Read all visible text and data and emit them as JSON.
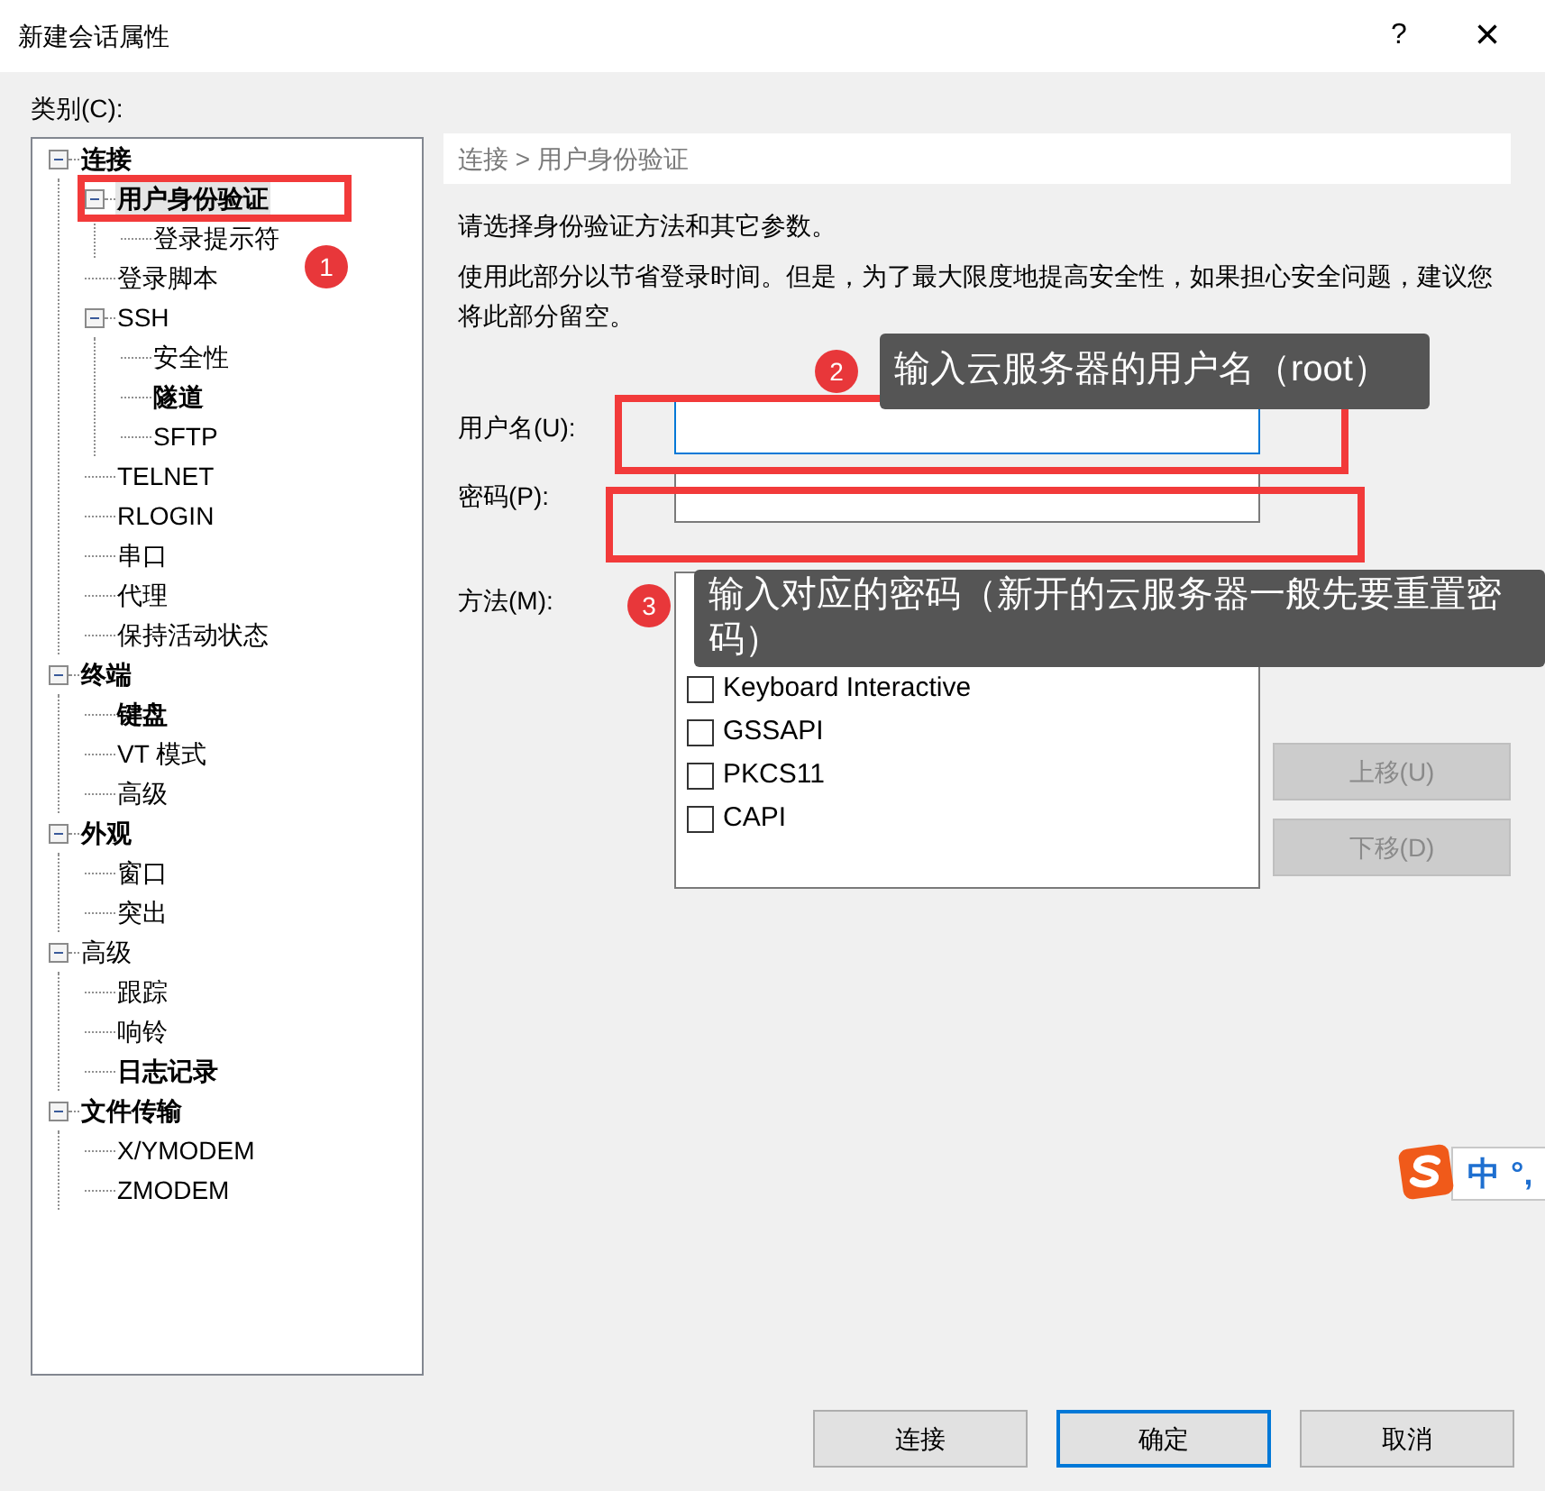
{
  "window": {
    "title": "新建会话属性",
    "help": "?",
    "close": "×"
  },
  "category_label": "类别(C):",
  "tree": [
    {
      "label": "连接",
      "modified": true,
      "selected": false,
      "expanded": true,
      "children": [
        {
          "label": "用户身份验证",
          "modified": true,
          "selected": true,
          "expanded": true,
          "children": [
            {
              "label": "登录提示符",
              "modified": false,
              "selected": false
            }
          ]
        },
        {
          "label": "登录脚本",
          "modified": false,
          "selected": false
        },
        {
          "label": "SSH",
          "modified": false,
          "selected": false,
          "expanded": true,
          "children": [
            {
              "label": "安全性",
              "modified": false,
              "selected": false
            },
            {
              "label": "隧道",
              "modified": true,
              "selected": false
            },
            {
              "label": "SFTP",
              "modified": false,
              "selected": false
            }
          ]
        },
        {
          "label": "TELNET",
          "modified": false,
          "selected": false
        },
        {
          "label": "RLOGIN",
          "modified": false,
          "selected": false
        },
        {
          "label": "串口",
          "modified": false,
          "selected": false
        },
        {
          "label": "代理",
          "modified": false,
          "selected": false
        },
        {
          "label": "保持活动状态",
          "modified": false,
          "selected": false
        }
      ]
    },
    {
      "label": "终端",
      "modified": true,
      "selected": false,
      "expanded": true,
      "children": [
        {
          "label": "键盘",
          "modified": true,
          "selected": false
        },
        {
          "label": "VT 模式",
          "modified": false,
          "selected": false
        },
        {
          "label": "高级",
          "modified": false,
          "selected": false
        }
      ]
    },
    {
      "label": "外观",
      "modified": true,
      "selected": false,
      "expanded": true,
      "children": [
        {
          "label": "窗口",
          "modified": false,
          "selected": false
        },
        {
          "label": "突出",
          "modified": false,
          "selected": false
        }
      ]
    },
    {
      "label": "高级",
      "modified": false,
      "selected": false,
      "expanded": true,
      "children": [
        {
          "label": "跟踪",
          "modified": false,
          "selected": false
        },
        {
          "label": "响铃",
          "modified": false,
          "selected": false
        },
        {
          "label": "日志记录",
          "modified": true,
          "selected": false
        }
      ]
    },
    {
      "label": "文件传输",
      "modified": true,
      "selected": false,
      "expanded": true,
      "children": [
        {
          "label": "X/YMODEM",
          "modified": false,
          "selected": false
        },
        {
          "label": "ZMODEM",
          "modified": false,
          "selected": false
        }
      ]
    }
  ],
  "breadcrumb": "连接 > 用户身份验证",
  "description": [
    "请选择身份验证方法和其它参数。",
    "使用此部分以节省登录时间。但是，为了最大限度地提高安全性，如果担心安全问题，建议您将此部分留空。"
  ],
  "username": {
    "label": "用户名(U):"
  },
  "password": {
    "label": "密码(P):"
  },
  "method": {
    "label": "方法(M):",
    "options": [
      {
        "label": "Keyboard Interactive",
        "checked": false
      },
      {
        "label": "GSSAPI",
        "checked": false
      },
      {
        "label": "PKCS11",
        "checked": false
      },
      {
        "label": "CAPI",
        "checked": false
      }
    ],
    "buttons": [
      {
        "label": "上移(U)",
        "disabled": true
      },
      {
        "label": "下移(D)",
        "disabled": true
      }
    ]
  },
  "buttons": [
    {
      "label": "连接",
      "default": false
    },
    {
      "label": "确定",
      "default": true
    },
    {
      "label": "取消",
      "default": false
    }
  ],
  "annotations": [
    {
      "number": "1"
    },
    {
      "number": "2",
      "text": "输入云服务器的用户名（root）"
    },
    {
      "number": "3",
      "text": "输入对应的密码（新开的云服务器一般先要重置密码）"
    }
  ],
  "ime_toolbar": {
    "mode": "中",
    "punctuation": "°,"
  }
}
